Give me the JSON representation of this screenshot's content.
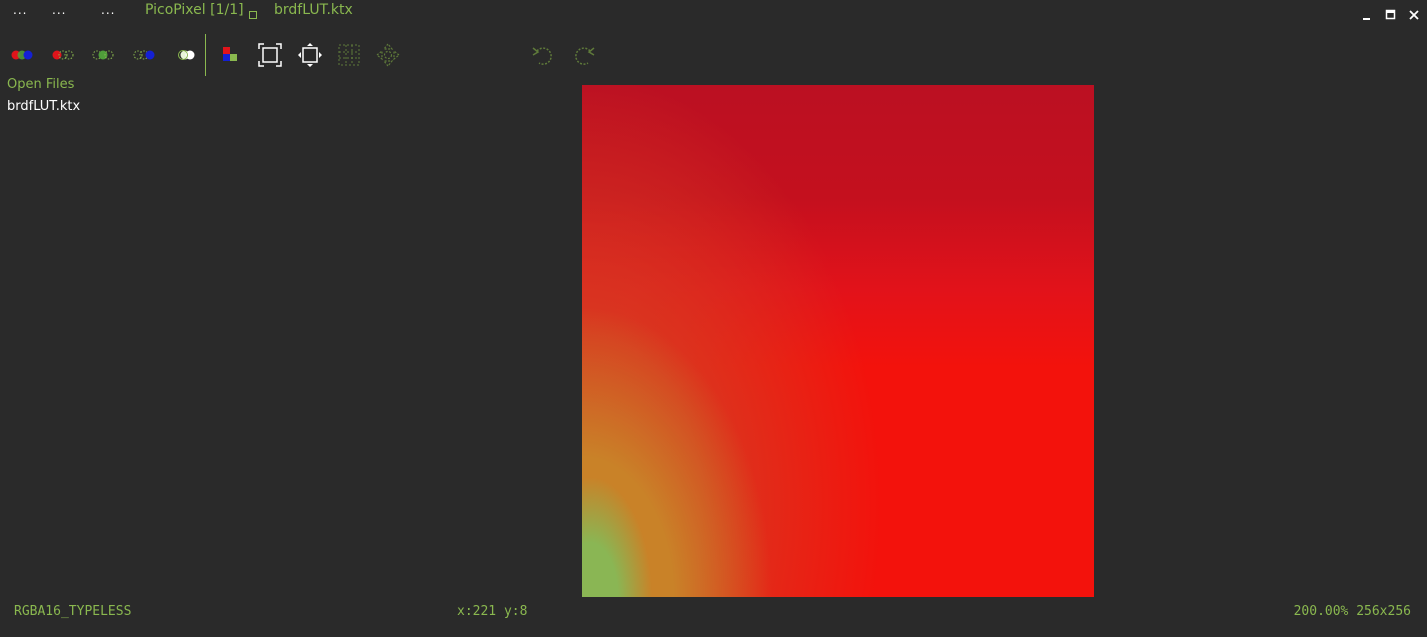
{
  "titlebar": {
    "menus": [
      "...",
      "...",
      "..."
    ],
    "app_title": "PicoPixel [1/1]",
    "file_tab": "brdfLUT.ktx"
  },
  "window_controls": [
    "minimize-icon",
    "maximize-icon",
    "close-icon"
  ],
  "toolbar": {
    "channel_toggles": [
      "rgb-channels-icon",
      "red-channel-icon",
      "green-channel-icon",
      "blue-channel-icon",
      "alpha-channel-icon"
    ],
    "view_tools": [
      "color-swatch-icon",
      "fit-to-window-icon",
      "actual-size-icon",
      "grid-icon",
      "pan-icon"
    ],
    "history": [
      "undo-icon",
      "redo-icon"
    ]
  },
  "sidebar": {
    "title": "Open Files",
    "files": [
      "brdfLUT.ktx"
    ]
  },
  "viewer": {
    "image_name": "brdfLUT.ktx"
  },
  "statusbar": {
    "format": "RGBA16_TYPELESS",
    "cursor": "x:221 y:8",
    "zoom_size": "200.00% 256x256"
  },
  "colors": {
    "accent": "#8ab84f",
    "background": "#2a2a2a",
    "text": "#ffffff"
  }
}
